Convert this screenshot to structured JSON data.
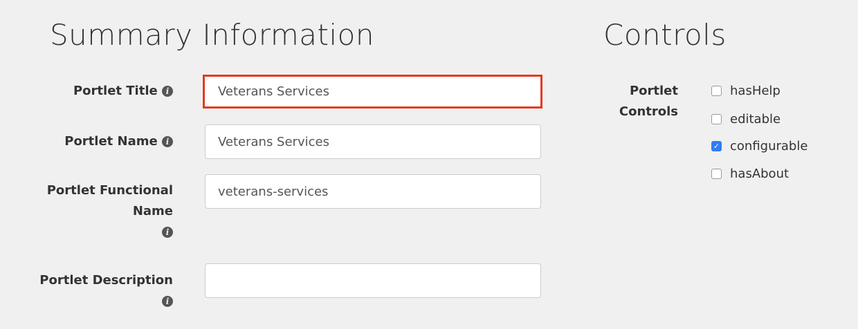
{
  "summary": {
    "heading": "Summary Information",
    "fields": [
      {
        "label": "Portlet Title",
        "value": "Veterans Services"
      },
      {
        "label": "Portlet Name",
        "value": "Veterans Services"
      },
      {
        "label_line1": "Portlet Functional",
        "label_line2": "Name",
        "value": "veterans-services"
      },
      {
        "label": "Portlet Description",
        "value": ""
      }
    ],
    "info_icon_glyph": "i"
  },
  "controls": {
    "heading": "Controls",
    "label_line1": "Portlet",
    "label_line2": "Controls",
    "options": [
      {
        "label": "hasHelp",
        "checked": false
      },
      {
        "label": "editable",
        "checked": false
      },
      {
        "label": "configurable",
        "checked": true
      },
      {
        "label": "hasAbout",
        "checked": false
      }
    ],
    "check_glyph": "✓"
  },
  "colors": {
    "highlight_border": "#e5391f",
    "checkbox_checked": "#2e7cf6",
    "panel_background": "#f0f0f0"
  }
}
